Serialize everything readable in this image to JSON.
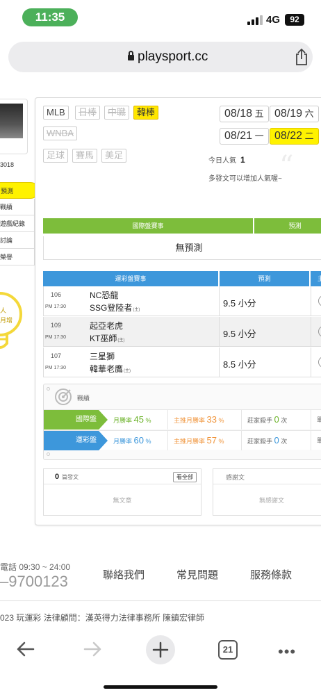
{
  "status_bar": {
    "time": "11:35",
    "network": "4G",
    "battery": "92"
  },
  "browser": {
    "url": "playsport.cc"
  },
  "sidebar": {
    "user_id": "3018",
    "items": [
      {
        "label": "預測",
        "active": true
      },
      {
        "label": "戰績",
        "active": false
      },
      {
        "label": "遊戲紀錄",
        "active": false
      },
      {
        "label": "討論",
        "active": false
      },
      {
        "label": "榮譽",
        "active": false
      }
    ],
    "bulb_text": [
      "人",
      "月增"
    ]
  },
  "league_tabs": [
    {
      "label": "MLB",
      "state": "normal"
    },
    {
      "label": "日棒",
      "state": "disabled"
    },
    {
      "label": "中職",
      "state": "disabled"
    },
    {
      "label": "韓棒",
      "state": "active"
    },
    {
      "label": "WNBA",
      "state": "disabled"
    },
    {
      "label": "足球",
      "state": "muted"
    },
    {
      "label": "賽馬",
      "state": "muted"
    },
    {
      "label": "美足",
      "state": "muted"
    }
  ],
  "dates": [
    {
      "date": "08/18",
      "day": "五",
      "active": false
    },
    {
      "date": "08/19",
      "day": "六",
      "active": false
    },
    {
      "date": "08/21",
      "day": "一",
      "active": false
    },
    {
      "date": "08/22",
      "day": "二",
      "active": true
    }
  ],
  "popularity": {
    "label": "今日人氣",
    "value": "1",
    "hint": "多發文可以增加人氣喔~"
  },
  "intl_table": {
    "col1": "國際盤賽事",
    "col2": "預測",
    "empty": "無預測"
  },
  "lottery_table": {
    "col1": "運彩盤賽事",
    "col2": "預測",
    "col3": "主",
    "home_mark": "(主)",
    "rows": [
      {
        "num": "106",
        "time": "PM 17:30",
        "away": "NC恐龍",
        "home": "SSG登陸者",
        "pred": "9.5 小分"
      },
      {
        "num": "109",
        "time": "PM 17:30",
        "away": "起亞老虎",
        "home": "KT巫師",
        "pred": "9.5 小分"
      },
      {
        "num": "107",
        "time": "PM 17:30",
        "away": "三星獅",
        "home": "韓華老鷹",
        "pred": "8.5 小分"
      }
    ]
  },
  "record": {
    "title": "戰績",
    "rows": [
      {
        "label": "國際盤",
        "month_label": "月勝率",
        "month": "45",
        "home_label": "主推月勝率",
        "home": "33",
        "killer_label": "莊家殺手",
        "killer": "0",
        "killer_unit": "次",
        "extra": "單",
        "color": "#7dbd3b"
      },
      {
        "label": "運彩盤",
        "month_label": "月勝率",
        "month": "60",
        "home_label": "主推月勝率",
        "home": "57",
        "killer_label": "莊家殺手",
        "killer": "0",
        "killer_unit": "次",
        "extra": "單",
        "color": "#3d97db"
      }
    ],
    "percent": "%"
  },
  "articles": {
    "count": "0",
    "count_label": "篇發文",
    "all_button": "看全部",
    "empty": "無文章"
  },
  "thanks": {
    "title": "感謝文",
    "empty": "無感謝文"
  },
  "footer": {
    "phone_label": "電話 09:30 ~ 24:00",
    "phone_number": "–9700123",
    "links": [
      "聯絡我們",
      "常見問題",
      "服務條款"
    ],
    "copyright": "023 玩運彩 法律顧問：漢英得力法律事務所 陳鎮宏律師"
  },
  "toolbar": {
    "tab_count": "21"
  }
}
